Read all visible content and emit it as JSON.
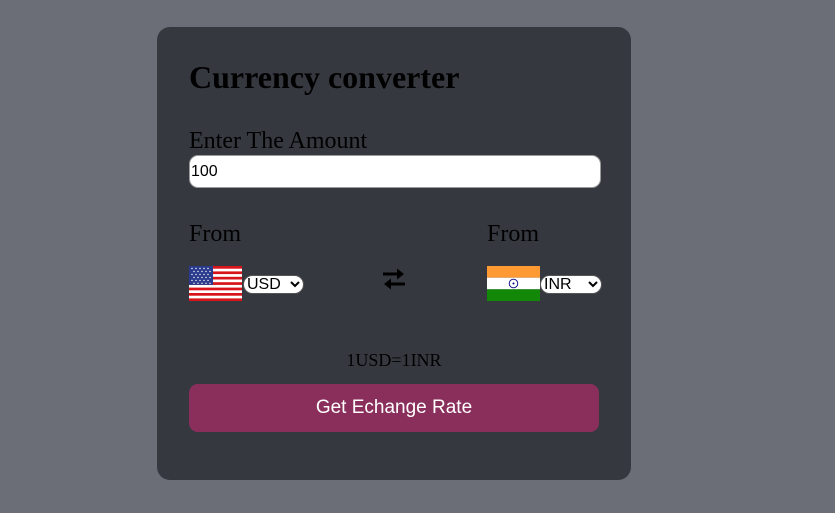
{
  "card": {
    "title": "Currency converter",
    "amount_label": "Enter The Amount",
    "amount_value": "100",
    "from_label_left": "From",
    "from_label_right": "From",
    "from_currency": {
      "selected": "USD",
      "flag": "us-flag-icon"
    },
    "to_currency": {
      "selected": "INR",
      "flag": "india-flag-icon"
    },
    "rate_text": "1USD=1INR",
    "button_label": "Get Echange Rate"
  },
  "colors": {
    "page_background": "#6b6e76",
    "card_background": "#363840",
    "button_background": "#8a2f5b",
    "button_text": "#ffffff"
  }
}
